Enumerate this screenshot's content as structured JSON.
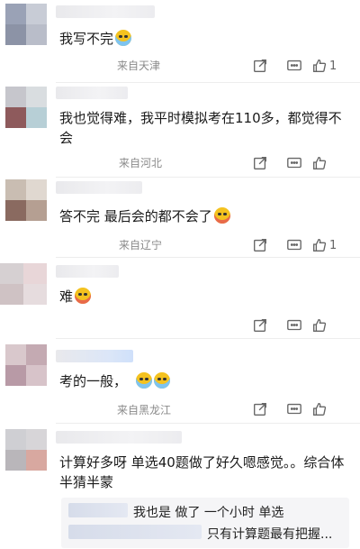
{
  "comments": [
    {
      "text": "我写不完",
      "emoji": "cry",
      "location": "来自天津",
      "likes": "1"
    },
    {
      "text": "我也觉得难，我平时模拟考在110多，都觉得不会",
      "emoji": "",
      "location": "来自河北",
      "likes": ""
    },
    {
      "text": "答不完 最后会的都不会了",
      "emoji": "laugh",
      "location": "来自辽宁",
      "likes": "1"
    },
    {
      "text": "难",
      "emoji": "laugh",
      "location": "",
      "likes": ""
    },
    {
      "text": "考的一般，",
      "emoji": "cry2",
      "location": "来自黑龙江",
      "likes": ""
    },
    {
      "text": "计算好多呀 单选40题做了好久嗯感觉。。综合体半猜半蒙",
      "emoji": "",
      "location": "",
      "likes": ""
    }
  ],
  "replies": [
    "我也是 做了 一个小时 单选",
    "只有计算题最有把握..."
  ],
  "icons": {
    "share": "share-icon",
    "comment": "comment-icon",
    "like": "thumbs-up-icon"
  },
  "colors": {
    "text": "#1a1a1a",
    "meta": "#8a8a8a",
    "emoji": "#f4c21f"
  }
}
